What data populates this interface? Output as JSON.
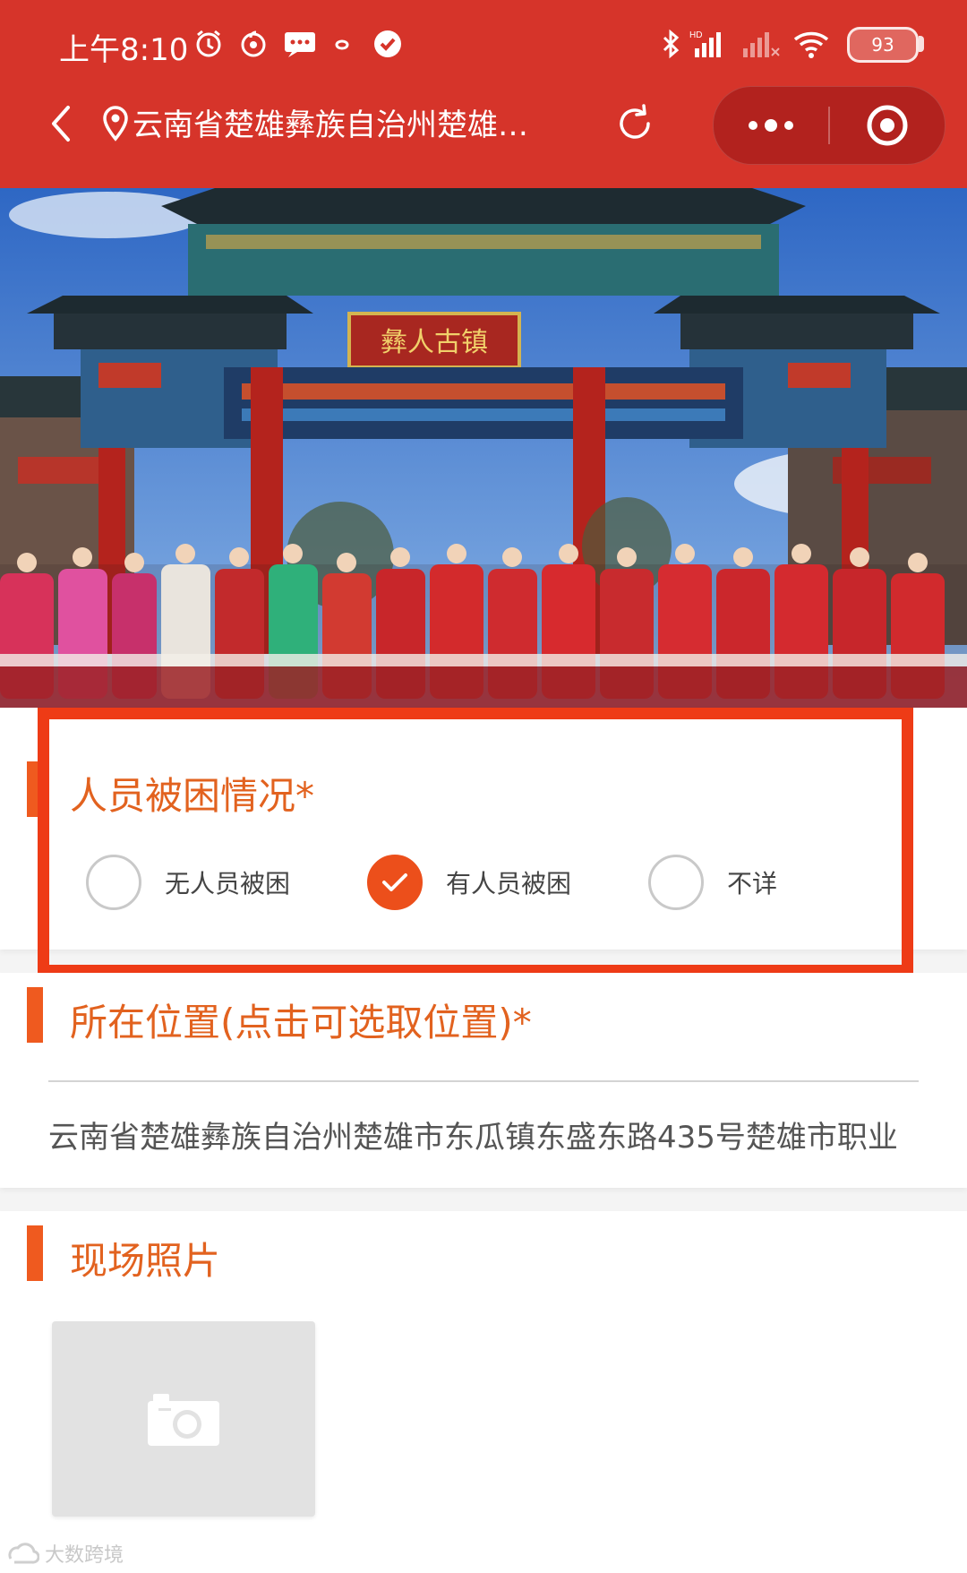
{
  "status_bar": {
    "time": "上午8:10",
    "battery": "93",
    "icons": [
      "alarm-icon",
      "netease-music-icon",
      "message-icon",
      "dot-icon",
      "check-badge-icon",
      "bluetooth-icon",
      "hd-signal-icon",
      "signal-icon",
      "wifi-icon"
    ]
  },
  "nav": {
    "title": "云南省楚雄彝族自治州楚雄…",
    "icons": [
      "back-icon",
      "location-pin-icon",
      "refresh-icon",
      "more-icon",
      "close-target-icon"
    ]
  },
  "banner": {
    "plaque_text": "彝人古镇",
    "colors": {
      "sky": "#3f7bd1",
      "gate_red": "#b4231d",
      "roof": "#24343a"
    }
  },
  "trapped": {
    "title": "人员被困情况*",
    "options": [
      {
        "label": "无人员被困",
        "checked": false
      },
      {
        "label": "有人员被困",
        "checked": true
      },
      {
        "label": "不详",
        "checked": false
      }
    ]
  },
  "location": {
    "title": "所在位置(点击可选取位置)*",
    "address": "云南省楚雄彝族自治州楚雄市东瓜镇东盛东路435号楚雄市职业"
  },
  "photos": {
    "title": "现场照片",
    "upload_icon": "camera-icon"
  },
  "watermark": "大数跨境",
  "colors": {
    "header": "#d6342a",
    "accent": "#ec4f1b",
    "highlight": "#ee3b16",
    "section_title": "#e2621f"
  }
}
